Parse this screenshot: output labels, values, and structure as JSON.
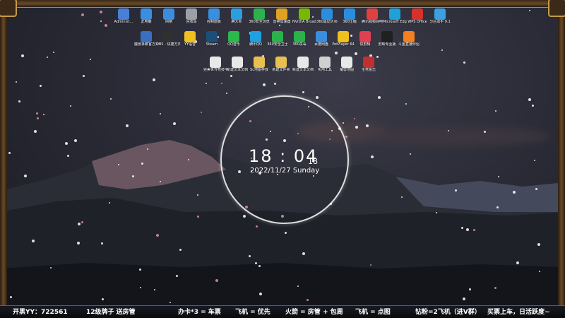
{
  "desktop": {
    "icons_row1": [
      {
        "label": "Administ...",
        "icon": "user-icon",
        "color": "#4a7fd6"
      },
      {
        "label": "此电脑",
        "icon": "computer-icon",
        "color": "#3a8ee0"
      },
      {
        "label": "网络",
        "icon": "network-icon",
        "color": "#3a8ee0"
      },
      {
        "label": "回收站",
        "icon": "recycle-bin-icon",
        "color": "#9aa0a8"
      },
      {
        "label": "控制面板",
        "icon": "control-panel-icon",
        "color": "#3a8ee0"
      },
      {
        "label": "腾大师",
        "icon": "master-icon",
        "color": "#2a9fe0"
      },
      {
        "label": "360安全浏览",
        "icon": "browser-icon",
        "color": "#2bb24c"
      },
      {
        "label": "雷神加速器",
        "icon": "accelerator-icon",
        "color": "#e0a020"
      },
      {
        "label": "NVIDIA Broadcast",
        "icon": "nvidia-icon",
        "color": "#76b900"
      },
      {
        "label": "360驱动大师",
        "icon": "driver-icon",
        "color": "#2a8ee0"
      },
      {
        "label": "360压缩",
        "icon": "zip-icon",
        "color": "#2a8ee0"
      },
      {
        "label": "腾讯视频网吧",
        "icon": "video-icon",
        "color": "#e04040"
      },
      {
        "label": "Microsoft Edge",
        "icon": "edge-icon",
        "color": "#1fa0d8"
      },
      {
        "label": "WPS Office",
        "icon": "wps-icon",
        "color": "#d8302a"
      },
      {
        "label": "分区助手 9.1",
        "icon": "partition-icon",
        "color": "#3aa0e0"
      }
    ],
    "icons_row2": [
      {
        "label": "魔兽争霸官方对战平台",
        "icon": "warcraft-icon",
        "color": "#3a70c0"
      },
      {
        "label": "OBS - 快捷方式",
        "icon": "obs-icon",
        "color": "#303030"
      },
      {
        "label": "YY语音",
        "icon": "yy-icon",
        "color": "#f0c020"
      },
      {
        "label": "Steam",
        "icon": "steam-icon",
        "color": "#1b4f7a"
      },
      {
        "label": "QQ音乐",
        "icon": "qqmusic-icon",
        "color": "#2cb84c"
      },
      {
        "label": "腾讯QQ",
        "icon": "qq-icon",
        "color": "#1fa0e0"
      },
      {
        "label": "360安全卫士",
        "icon": "shield-icon",
        "color": "#2bb24c"
      },
      {
        "label": "360杀毒",
        "icon": "antivirus-icon",
        "color": "#2bb24c"
      },
      {
        "label": "百度网盘",
        "icon": "cloud-drive-icon",
        "color": "#3a8ee0"
      },
      {
        "label": "PotPlayer 64",
        "icon": "player-icon",
        "color": "#f0c020"
      },
      {
        "label": "快剪辑",
        "icon": "cut-icon",
        "color": "#e04050"
      },
      {
        "label": "剪映专业版",
        "icon": "capcut-icon",
        "color": "#202020"
      },
      {
        "label": "斗鱼直播伴侣",
        "icon": "douyu-icon",
        "color": "#f08020"
      }
    ],
    "icons_row3": [
      {
        "label": "完美世界竞技平台",
        "icon": "file-icon",
        "color": "#e8e8e8"
      },
      {
        "label": "新建文本文档",
        "icon": "file-icon",
        "color": "#e8e8e8"
      },
      {
        "label": "Sc地图存放",
        "icon": "folder-icon",
        "color": "#e8c050"
      },
      {
        "label": "新建文件夹",
        "icon": "folder-icon",
        "color": "#e8c050"
      },
      {
        "label": "新建文本文档",
        "icon": "file-icon",
        "color": "#e8e8e8"
      },
      {
        "label": "实用工具",
        "icon": "tools-icon",
        "color": "#d0d0d0"
      },
      {
        "label": "魔兽地图",
        "icon": "file-icon",
        "color": "#e8e8e8"
      },
      {
        "label": "生死狙击",
        "icon": "game-icon",
        "color": "#c03030"
      }
    ]
  },
  "clock": {
    "time": "18 : 04",
    "seconds": "18",
    "date": "2022/11/27 Sunday"
  },
  "ticker": {
    "items": [
      "开黑YY：722561",
      "12级牌子 送房管",
      "办卡*3 = 车票",
      "飞机 = 优先",
      "火箭 = 房管 + 包周",
      "飞机 = 点图",
      "钻粉=2飞机（进V群）",
      "买票上车，日活跃度~"
    ],
    "color": "#ffffff"
  }
}
